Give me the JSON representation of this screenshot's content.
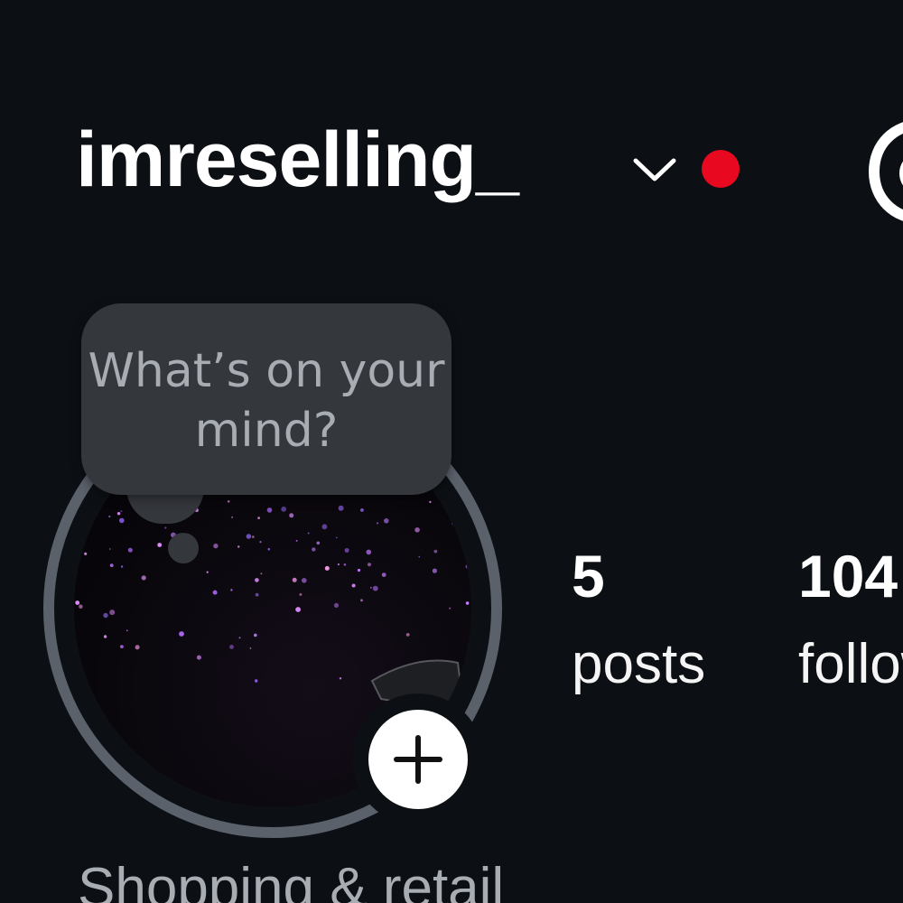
{
  "header": {
    "username": "imreselling_",
    "chevron_icon": "chevron-down-icon",
    "notification_dot_color": "#e8081f",
    "threads_icon": "threads-icon"
  },
  "note": {
    "placeholder": "What’s on your mind?"
  },
  "avatar": {
    "description_icon": "profile-avatar",
    "add_icon": "plus-icon"
  },
  "stats": [
    {
      "value": "5",
      "label": "posts"
    },
    {
      "value": "104",
      "label": "followers"
    }
  ],
  "profile": {
    "category": "Shopping & retail"
  },
  "colors": {
    "background": "#0c1014",
    "note_bubble": "#34373c",
    "ring": "#5b616b",
    "secondary_text": "#a8acb3"
  }
}
